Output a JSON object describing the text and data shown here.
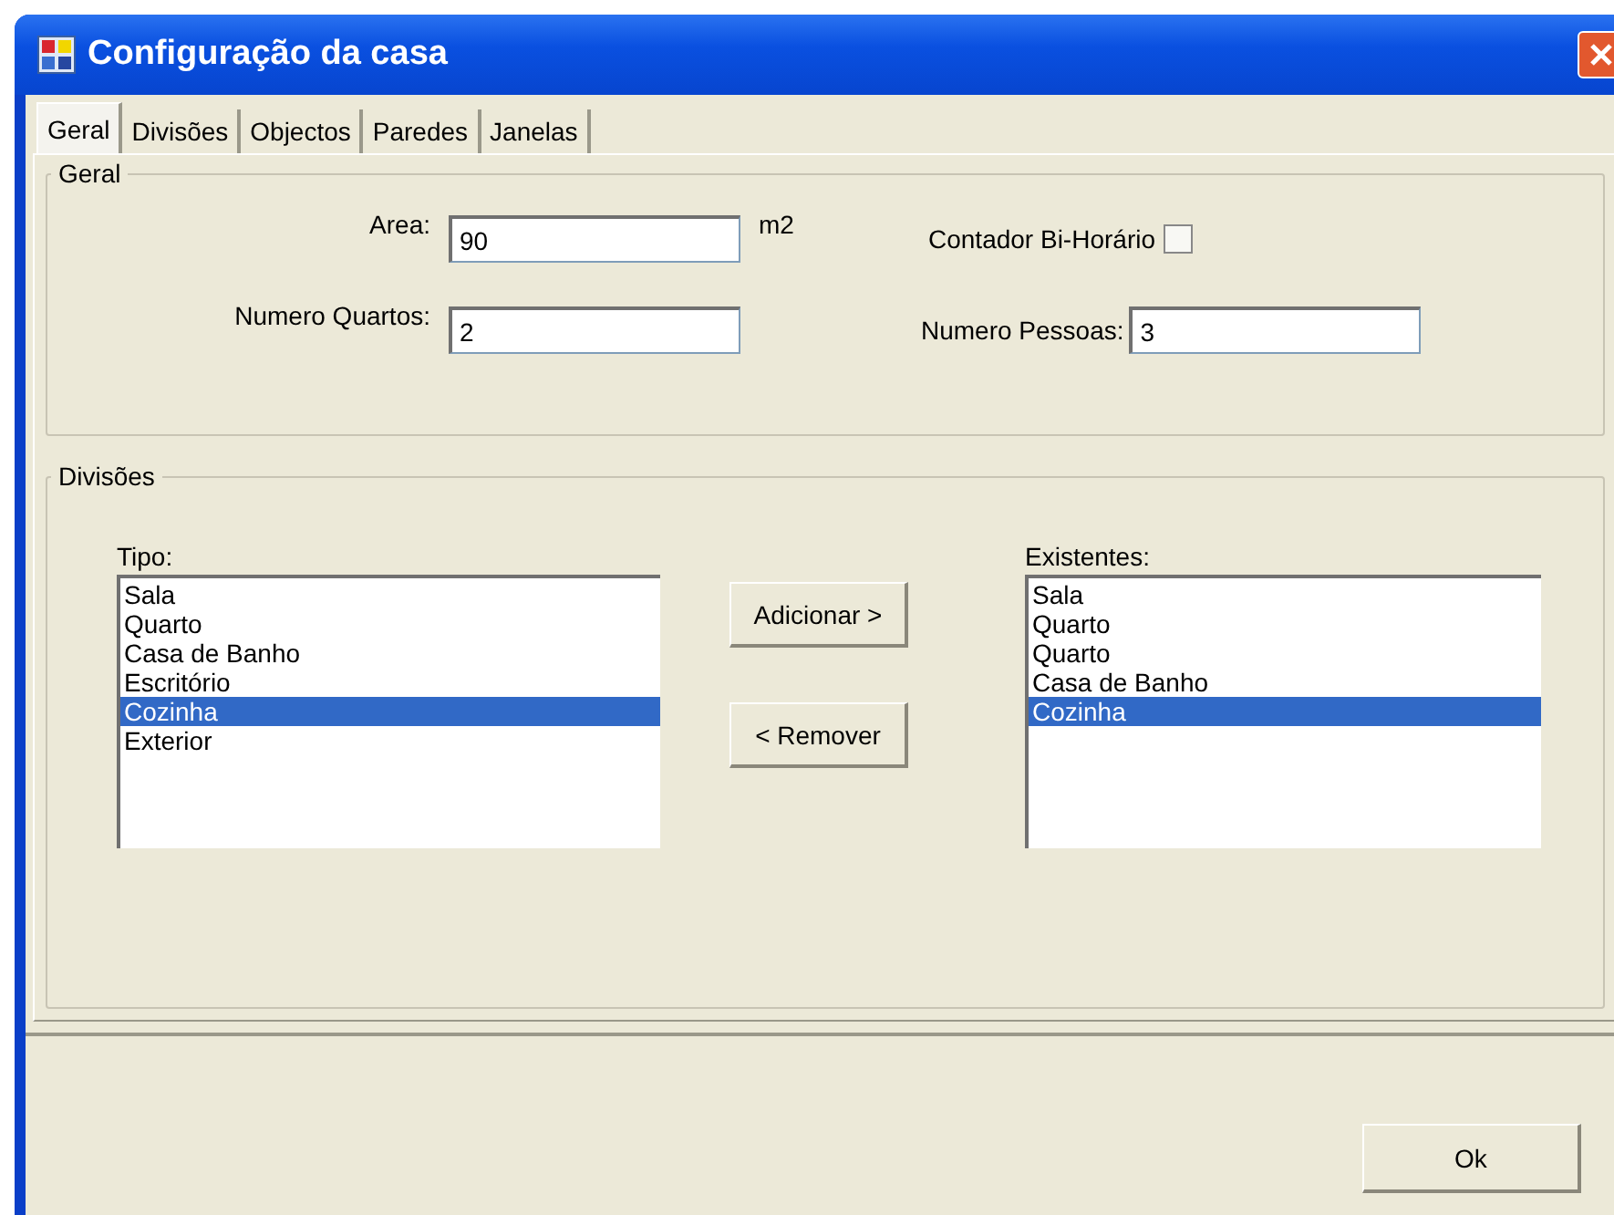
{
  "window": {
    "title": "Configuração da casa"
  },
  "tabs": [
    {
      "label": "Geral",
      "selected": true
    },
    {
      "label": "Divisões",
      "selected": false
    },
    {
      "label": "Objectos",
      "selected": false
    },
    {
      "label": "Paredes",
      "selected": false
    },
    {
      "label": "Janelas",
      "selected": false
    }
  ],
  "geral": {
    "title": "Geral",
    "area": {
      "label": "Area:",
      "value": "90",
      "unit": "m2"
    },
    "contador": {
      "label": "Contador Bi-Horário",
      "checked": false
    },
    "quartos": {
      "label": "Numero Quartos:",
      "value": "2"
    },
    "pessoas": {
      "label": "Numero Pessoas:",
      "value": "3"
    }
  },
  "divisoes": {
    "title": "Divisões",
    "tipo": {
      "label": "Tipo:",
      "items": [
        {
          "label": "Sala",
          "selected": false
        },
        {
          "label": "Quarto",
          "selected": false
        },
        {
          "label": "Casa de Banho",
          "selected": false
        },
        {
          "label": "Escritório",
          "selected": false
        },
        {
          "label": "Cozinha",
          "selected": true
        },
        {
          "label": "Exterior",
          "selected": false
        }
      ]
    },
    "buttons": [
      "Adicionar >",
      "< Remover"
    ],
    "existentes": {
      "label": "Existentes:",
      "items": [
        {
          "label": "Sala",
          "selected": false
        },
        {
          "label": "Quarto",
          "selected": false
        },
        {
          "label": "Quarto",
          "selected": false
        },
        {
          "label": "Casa de Banho",
          "selected": false
        },
        {
          "label": "Cozinha",
          "selected": true
        }
      ]
    }
  },
  "ok_button": "Ok"
}
